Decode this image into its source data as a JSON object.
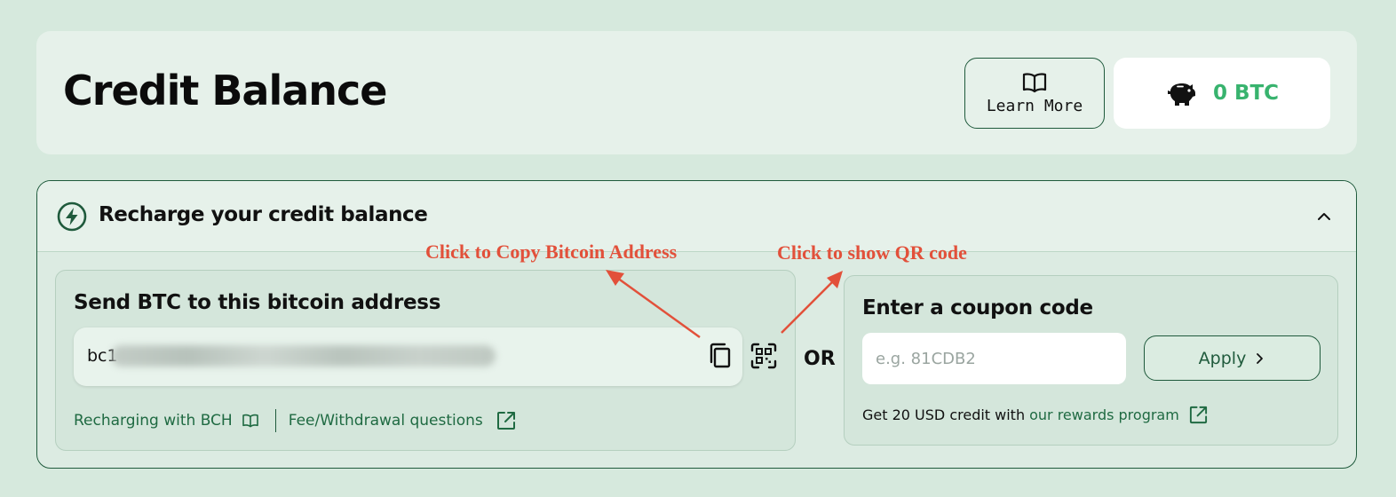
{
  "header": {
    "title": "Credit Balance",
    "learn_more_label": "Learn More",
    "balance": "0 BTC"
  },
  "recharge": {
    "title": "Recharge your credit balance",
    "btc": {
      "title": "Send BTC to this bitcoin address",
      "address_prefix": "bc1",
      "link_bch": "Recharging with BCH",
      "link_fee": "Fee/Withdrawal questions"
    },
    "or_label": "OR",
    "coupon": {
      "title": "Enter a coupon code",
      "placeholder": "e.g. 81CDB2",
      "apply_label": "Apply",
      "footer_text": "Get 20 USD credit with",
      "footer_link": "our rewards program"
    }
  },
  "annotations": {
    "copy": "Click to Copy Bitcoin Address",
    "qr": "Click to show QR code"
  },
  "colors": {
    "accent": "#1f5a3c",
    "balance": "#38b36e",
    "annotation": "#e2503a"
  },
  "icons": [
    "book-icon",
    "piggy-bank-icon",
    "lightning-icon",
    "chevron-up-icon",
    "copy-icon",
    "qr-code-icon",
    "external-link-icon",
    "chevron-right-icon"
  ]
}
